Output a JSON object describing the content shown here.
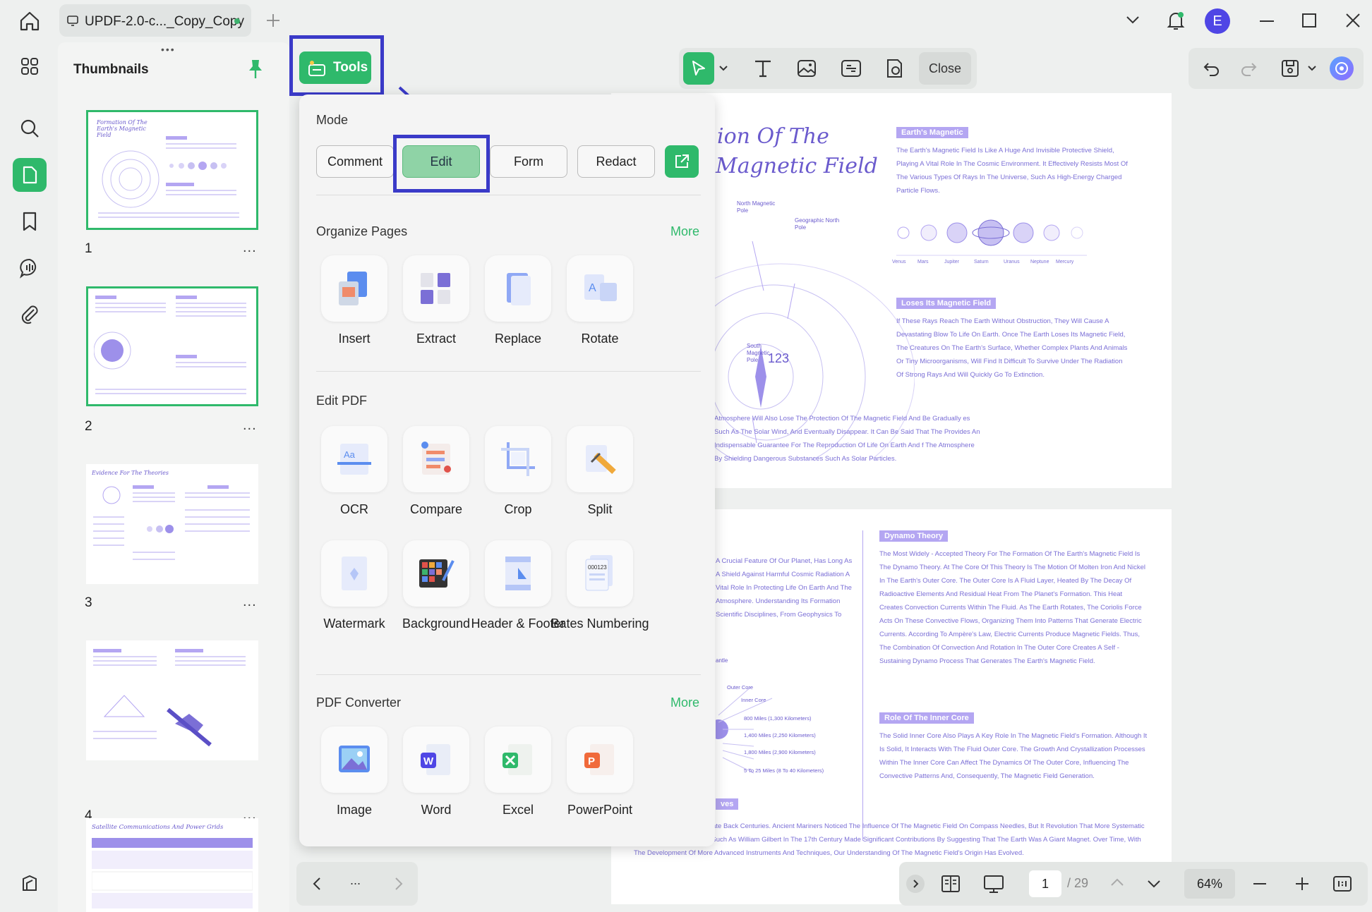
{
  "titlebar": {
    "tab_title": "UPDF-2.0-c..._Copy_Copy",
    "avatar_letter": "E"
  },
  "thumbnails": {
    "title": "Thumbnails",
    "pages": [
      {
        "num": "1",
        "heading": "Formation Of The Earth's Magnetic Field"
      },
      {
        "num": "2",
        "heading": ""
      },
      {
        "num": "3",
        "heading": "Evidence For The Theories"
      },
      {
        "num": "4",
        "heading": ""
      },
      {
        "num": "",
        "heading": "Satellite Communications And Power Grids"
      }
    ],
    "more": "..."
  },
  "toolbar": {
    "tools_label": "Tools",
    "close_label": "Close"
  },
  "panel": {
    "mode_title": "Mode",
    "modes": [
      "Comment",
      "Edit",
      "Form",
      "Redact"
    ],
    "organize_title": "Organize Pages",
    "organize_more": "More",
    "organize": [
      "Insert",
      "Extract",
      "Replace",
      "Rotate"
    ],
    "edit_title": "Edit PDF",
    "edit_row1": [
      "OCR",
      "Compare",
      "Crop",
      "Split"
    ],
    "edit_row2": [
      "Watermark",
      "Background",
      "Header & Footer",
      "Bates Numbering"
    ],
    "converter_title": "PDF Converter",
    "converter_more": "More",
    "converter": [
      "Image",
      "Word",
      "Excel",
      "PowerPoint"
    ]
  },
  "page1": {
    "title_line1": "ion Of The",
    "title_line2": "Magnetic Field",
    "tag1": "Earth's Magnetic",
    "text1": "The Earth's Magnetic Field Is Like A Huge And Invisible Protective Shield, Playing A Vital Role In The Cosmic Environment. It Effectively Resists Most Of The Various Types Of Rays In The Universe, Such As High-Energy Charged Particle Flows.",
    "tag2": "Loses Its Magnetic Field",
    "text2": "If These Rays Reach The Earth Without Obstruction, They Will Cause A Devastating Blow To Life On Earth. Once The Earth Loses Its Magnetic Field, The Creatures On The Earth's Surface, Whether Complex Plants And Animals Or Tiny Microorganisms, Will Find It Difficult To Survive Under The Radiation Of Strong Rays And Will Quickly Go To Extinction.",
    "text3": "Atmosphere Will Also Lose The Protection Of The Magnetic Field And Be Gradually es Such As The Solar Wind, And Eventually Disappear. It Can Be Said That The Provides An Indispensable Guarantee For The Reproduction Of Life On Earth And f The Atmosphere By Shielding Dangerous Substances Such As Solar Particles.",
    "planets": [
      "Venus",
      "Mars",
      "Jupiter",
      "Saturn",
      "Uranus",
      "Neptune",
      "Mercury"
    ],
    "north_pole": "North Magnetic Pole",
    "geo_north": "Geographic North Pole",
    "south_pole": "South Magnetic Pole",
    "num": "123"
  },
  "page2": {
    "tag1": "Dynamo Theory",
    "text1": "The Most Widely - Accepted Theory For The Formation Of The Earth's Magnetic Field Is The Dynamo Theory. At The Core Of This Theory Is The Motion Of Molten Iron And Nickel In The Earth's Outer Core. The Outer Core Is A Fluid Layer, Heated By The Decay Of Radioactive Elements And Residual Heat From The Planet's Formation. This Heat Creates Convection Currents Within The Fluid. As The Earth Rotates, The Coriolis Force Acts On These Convective Flows, Organizing Them Into Patterns That Generate Electric Currents. According To Ampère's Law, Electric Currents Produce Magnetic Fields. Thus, The Combination Of Convection And Rotation In The Outer Core Creates A Self - Sustaining Dynamo Process That Generates The Earth's Magnetic Field.",
    "tag2": "Role Of The Inner Core",
    "text2": "The Solid Inner Core Also Plays A Key Role In The Magnetic Field's Formation. Although It Is Solid, It Interacts With The Fluid Outer Core. The Growth And Crystallization Processes Within The Inner Core Can Affect The Dynamics Of The Outer Core, Influencing The Convective Patterns And, Consequently, The Magnetic Field Generation.",
    "left_text": "A Crucial Feature Of Our Planet, Has Long As A Shield Against Harmful Cosmic Radiation A Vital Role In Protecting Life On Earth And The Atmosphere. Understanding Its Formation Scientific Disciplines, From Geophysics To",
    "layers": [
      "Outer Core",
      "Inner Core",
      "800 Miles (1,300 Kilometers)",
      "1,400 Miles (2,250 Kilometers)",
      "1,800 Miles (2,900 Kilometers)",
      "5 To 25 Miles (8 To 40 Kilometers)"
    ],
    "mantle": "antle",
    "ves": "ves",
    "bottom_text": "e Earth's Magnetic Field Date Back Centuries. Ancient Mariners Noticed The Influence Of The Magnetic Field On Compass Needles, But It Revolution That More Systematic Studies Began. Scientists Such As William Gilbert In The 17th Century Made Significant Contributions By Suggesting That The Earth Was A Giant Magnet. Over Time, With The Development Of More Advanced Instruments And Techniques, Our Understanding Of The Magnetic Field's Origin Has Evolved."
  },
  "pager": {
    "dots": "..."
  },
  "bottombar": {
    "page_current": "1",
    "page_total": "/ 29",
    "zoom": "64%"
  },
  "colors": {
    "accent": "#2fb96b",
    "highlight": "#3a3ac8",
    "doc_purple": "#7b6fd6"
  }
}
